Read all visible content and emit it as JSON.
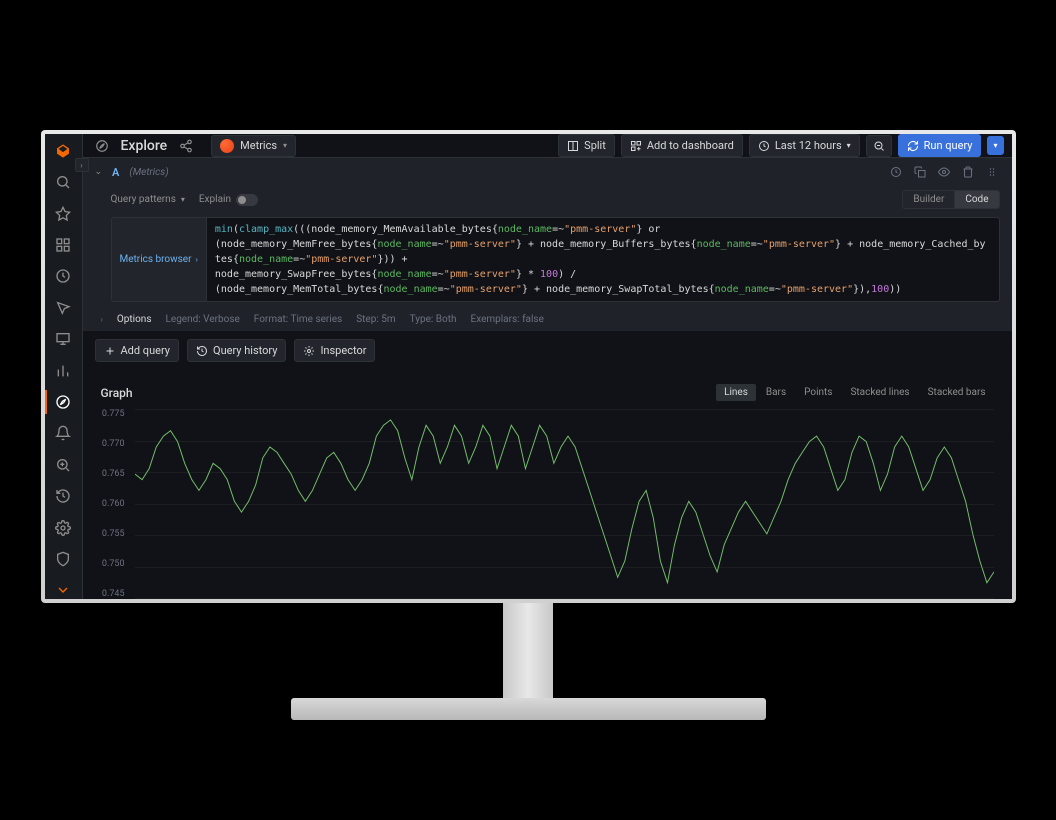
{
  "page": {
    "title": "Explore"
  },
  "datasource": {
    "name": "Metrics"
  },
  "topbar": {
    "split": "Split",
    "addDashboard": "Add to dashboard",
    "timeRange": "Last 12 hours",
    "runQuery": "Run query"
  },
  "query": {
    "letter": "A",
    "parenthesis": "(Metrics)",
    "patternsLabel": "Query patterns",
    "explainLabel": "Explain",
    "modes": {
      "builder": "Builder",
      "code": "Code",
      "active": "code"
    },
    "metricsBrowser": "Metrics browser",
    "code": {
      "parts": [
        {
          "t": "kw",
          "v": "min"
        },
        {
          "t": "",
          "v": "("
        },
        {
          "t": "kw",
          "v": "clamp_max"
        },
        {
          "t": "",
          "v": "(((node_memory_MemAvailable_bytes{"
        },
        {
          "t": "lbl",
          "v": "node_name"
        },
        {
          "t": "",
          "v": "=~"
        },
        {
          "t": "str",
          "v": "\"pmm-server\""
        },
        {
          "t": "",
          "v": "} or\n(node_memory_MemFree_bytes{"
        },
        {
          "t": "lbl",
          "v": "node_name"
        },
        {
          "t": "",
          "v": "=~"
        },
        {
          "t": "str",
          "v": "\"pmm-server\""
        },
        {
          "t": "",
          "v": "} + node_memory_Buffers_bytes{"
        },
        {
          "t": "lbl",
          "v": "node_name"
        },
        {
          "t": "",
          "v": "=~"
        },
        {
          "t": "str",
          "v": "\"pmm-server\""
        },
        {
          "t": "",
          "v": "} + node_memory_Cached_bytes{"
        },
        {
          "t": "lbl",
          "v": "node_name"
        },
        {
          "t": "",
          "v": "=~"
        },
        {
          "t": "str",
          "v": "\"pmm-server\""
        },
        {
          "t": "",
          "v": "})) +\nnode_memory_SwapFree_bytes{"
        },
        {
          "t": "lbl",
          "v": "node_name"
        },
        {
          "t": "",
          "v": "=~"
        },
        {
          "t": "str",
          "v": "\"pmm-server\""
        },
        {
          "t": "",
          "v": "} * "
        },
        {
          "t": "num",
          "v": "100"
        },
        {
          "t": "",
          "v": ") /\n(node_memory_MemTotal_bytes{"
        },
        {
          "t": "lbl",
          "v": "node_name"
        },
        {
          "t": "",
          "v": "=~"
        },
        {
          "t": "str",
          "v": "\"pmm-server\""
        },
        {
          "t": "",
          "v": "} + node_memory_SwapTotal_bytes{"
        },
        {
          "t": "lbl",
          "v": "node_name"
        },
        {
          "t": "",
          "v": "=~"
        },
        {
          "t": "str",
          "v": "\"pmm-server\""
        },
        {
          "t": "",
          "v": "}),"
        },
        {
          "t": "num",
          "v": "100"
        },
        {
          "t": "",
          "v": "))"
        }
      ]
    },
    "options": {
      "title": "Options",
      "legend": "Legend: Verbose",
      "format": "Format: Time series",
      "step": "Step: 5m",
      "type": "Type: Both",
      "exemplars": "Exemplars: false"
    }
  },
  "buttons": {
    "addQuery": "Add query",
    "queryHistory": "Query history",
    "inspector": "Inspector"
  },
  "graph": {
    "title": "Graph",
    "modes": [
      "Lines",
      "Bars",
      "Points",
      "Stacked lines",
      "Stacked bars"
    ],
    "activeMode": "Lines"
  },
  "chart_data": {
    "type": "line",
    "ylabel": "",
    "ylim": [
      0.74,
      0.775
    ],
    "yticks": [
      0.775,
      0.77,
      0.765,
      0.76,
      0.755,
      0.75,
      0.745
    ],
    "series": [
      {
        "name": "",
        "color": "#73bf69",
        "values": [
          0.763,
          0.762,
          0.764,
          0.768,
          0.77,
          0.771,
          0.769,
          0.765,
          0.762,
          0.76,
          0.762,
          0.765,
          0.764,
          0.762,
          0.758,
          0.756,
          0.758,
          0.761,
          0.766,
          0.768,
          0.767,
          0.765,
          0.763,
          0.76,
          0.758,
          0.76,
          0.763,
          0.766,
          0.767,
          0.765,
          0.762,
          0.76,
          0.762,
          0.765,
          0.77,
          0.772,
          0.773,
          0.771,
          0.766,
          0.762,
          0.768,
          0.772,
          0.77,
          0.765,
          0.768,
          0.772,
          0.77,
          0.765,
          0.768,
          0.772,
          0.77,
          0.764,
          0.768,
          0.772,
          0.77,
          0.764,
          0.768,
          0.772,
          0.77,
          0.765,
          0.768,
          0.77,
          0.768,
          0.764,
          0.76,
          0.756,
          0.752,
          0.748,
          0.744,
          0.747,
          0.753,
          0.758,
          0.76,
          0.755,
          0.747,
          0.743,
          0.75,
          0.755,
          0.758,
          0.756,
          0.752,
          0.748,
          0.745,
          0.75,
          0.753,
          0.756,
          0.758,
          0.756,
          0.754,
          0.752,
          0.755,
          0.758,
          0.762,
          0.765,
          0.767,
          0.769,
          0.77,
          0.768,
          0.764,
          0.76,
          0.762,
          0.767,
          0.77,
          0.769,
          0.765,
          0.76,
          0.763,
          0.768,
          0.77,
          0.768,
          0.764,
          0.76,
          0.762,
          0.766,
          0.768,
          0.766,
          0.762,
          0.758,
          0.752,
          0.747,
          0.743,
          0.745
        ]
      }
    ]
  }
}
